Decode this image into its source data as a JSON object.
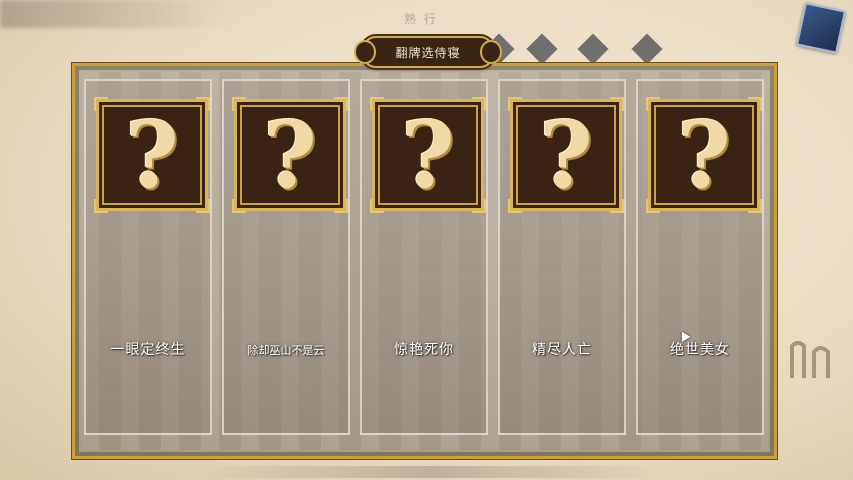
{
  "header": {
    "bg_title": "熟 行",
    "panel_title": "翻牌选侍寝"
  },
  "cards": [
    {
      "label": "一眼定终生",
      "face": "?"
    },
    {
      "label": "除却巫山不是云",
      "face": "?"
    },
    {
      "label": "惊艳死你",
      "face": "?"
    },
    {
      "label": "精尽人亡",
      "face": "?"
    },
    {
      "label": "绝世美女",
      "face": "?"
    }
  ],
  "icons": {
    "top_right": "book-icon",
    "card_face": "question-mark-icon",
    "cursor": "mouse-cursor-icon"
  },
  "colors": {
    "frame_gold": "#d9b45a",
    "frame_dark": "#3b2314",
    "panel_border": "#c9a03c"
  }
}
